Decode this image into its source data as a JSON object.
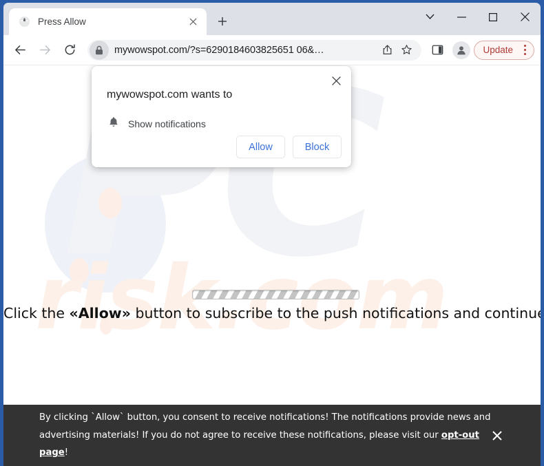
{
  "browser": {
    "tab": {
      "title": "Press Allow",
      "favicon": "globe-icon"
    },
    "new_tab_label": "+",
    "window_controls": {
      "tab_search": "tab-search-chevron",
      "minimize": "minimize",
      "maximize": "maximize",
      "close": "close"
    },
    "nav": {
      "back": "back-arrow",
      "forward": "forward-arrow",
      "reload": "reload"
    },
    "omnibox": {
      "lock_icon": "lock-icon",
      "url": "mywowspot.com/?s=6290184603825651 06&…",
      "share_icon": "share-icon",
      "bookmark_icon": "star-icon"
    },
    "toolbar": {
      "side_panel_icon": "side-panel-icon",
      "avatar_icon": "profile-avatar-icon",
      "update_label": "Update",
      "menu_icon": "three-dot-menu-icon"
    }
  },
  "permission_dialog": {
    "title": "mywowspot.com wants to",
    "request_icon": "bell-icon",
    "request_label": "Show notifications",
    "allow_label": "Allow",
    "block_label": "Block",
    "close_icon": "close-icon"
  },
  "page": {
    "headline_prefix": "Click the ",
    "headline_emphasis": "«Allow»",
    "headline_suffix": " button to subscribe to the push notifications and continue watching",
    "progress_bar": "indeterminate-striped-progress",
    "watermark_top": "PC",
    "watermark_bottom": "risk.com"
  },
  "consent_bar": {
    "text_before_link": "By clicking `Allow` button, you consent to receive notifications! The notifications provide news and advertising materials! If you do not agree to receive these notifications, please visit our ",
    "link_label": "opt-out page",
    "text_after_link": "!",
    "close_icon": "close-icon"
  },
  "colors": {
    "window_frame": "#2a5ca8",
    "titlebar": "#dde1e7",
    "accent_blue": "#3b72d9",
    "update_red": "#b03a34",
    "consent_bg": "#333333"
  }
}
